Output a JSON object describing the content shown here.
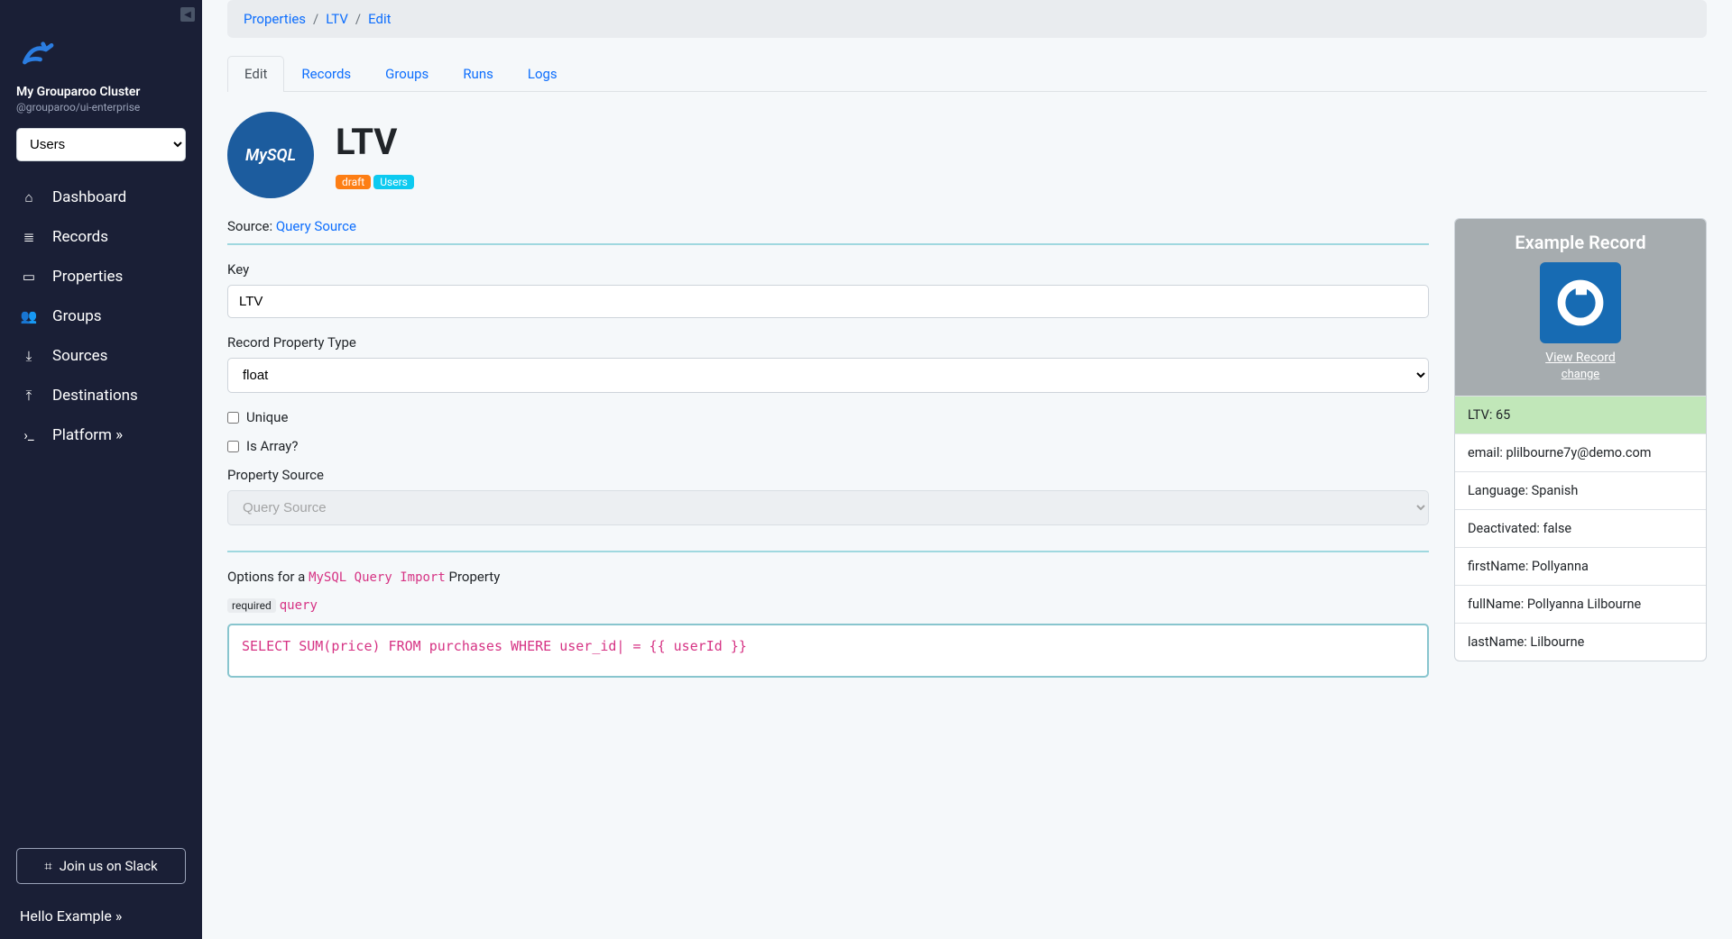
{
  "sidebar": {
    "cluster_name": "My Grouparoo Cluster",
    "cluster_package": "@grouparoo/ui-enterprise",
    "select_value": "Users",
    "items": [
      {
        "label": "Dashboard",
        "icon": "home"
      },
      {
        "label": "Records",
        "icon": "list"
      },
      {
        "label": "Properties",
        "icon": "id-card"
      },
      {
        "label": "Groups",
        "icon": "users"
      },
      {
        "label": "Sources",
        "icon": "file-import"
      },
      {
        "label": "Destinations",
        "icon": "file-export"
      },
      {
        "label": "Platform »",
        "icon": "terminal"
      }
    ],
    "slack_label": "Join us on Slack",
    "hello_label": "Hello Example »"
  },
  "breadcrumb": [
    {
      "label": "Properties",
      "link": true
    },
    {
      "label": "LTV",
      "link": true
    },
    {
      "label": "Edit",
      "link": true
    }
  ],
  "tabs": [
    {
      "label": "Edit",
      "active": true
    },
    {
      "label": "Records"
    },
    {
      "label": "Groups"
    },
    {
      "label": "Runs"
    },
    {
      "label": "Logs"
    }
  ],
  "title": "LTV",
  "badges": [
    {
      "label": "draft",
      "cls": "badge-draft"
    },
    {
      "label": "Users",
      "cls": "badge-users"
    }
  ],
  "source_label": "Source",
  "source_link": "Query Source",
  "form": {
    "key_label": "Key",
    "key_value": "LTV",
    "type_label": "Record Property Type",
    "type_value": "float",
    "unique_label": "Unique",
    "array_label": "Is Array?",
    "propsource_label": "Property Source",
    "propsource_value": "Query Source",
    "options_prefix": "Options for a ",
    "options_code": "MySQL Query Import",
    "options_suffix": " Property",
    "required_label": "required",
    "query_label": "query",
    "query_value": "SELECT SUM(price) FROM purchases WHERE user_id| = {{ userId }}"
  },
  "example": {
    "title": "Example Record",
    "view_label": "View Record",
    "change_label": "change",
    "rows": [
      {
        "k": "LTV",
        "v": "65",
        "highlight": true
      },
      {
        "k": "email",
        "v": "plilbourne7y@demo.com"
      },
      {
        "k": "Language",
        "v": "Spanish"
      },
      {
        "k": "Deactivated",
        "v": "false"
      },
      {
        "k": "firstName",
        "v": "Pollyanna"
      },
      {
        "k": "fullName",
        "v": "Pollyanna Lilbourne"
      },
      {
        "k": "lastName",
        "v": "Lilbourne"
      }
    ]
  }
}
